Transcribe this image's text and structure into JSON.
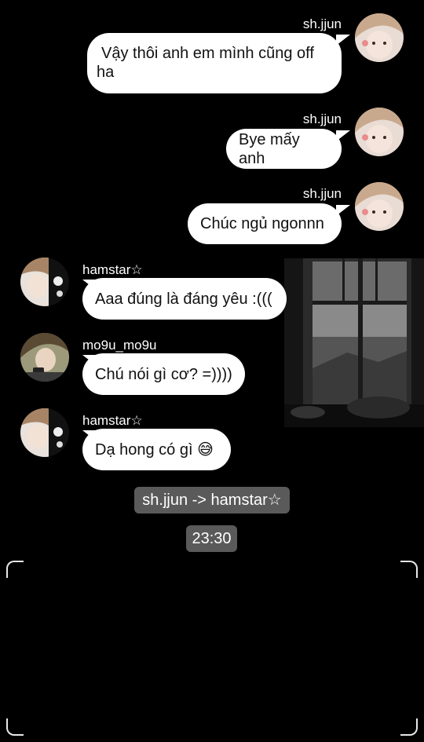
{
  "messages": [
    {
      "sender": "sh.jjun",
      "text": "Vậy thôi anh em mình cũng off ha",
      "line1": "Vậy thôi anh em mình cũng off",
      "line2": "ha"
    },
    {
      "sender": "sh.jjun",
      "text": "Bye mấy anh"
    },
    {
      "sender": "sh.jjun",
      "text": "Chúc ngủ ngonnn"
    },
    {
      "sender": "hamstar☆",
      "text": "Aaa đúng là đáng yêu :((("
    },
    {
      "sender": "mo9u_mo9u",
      "text": "Chú nói gì cơ? =))))"
    },
    {
      "sender": "hamstar☆",
      "text": "Dạ hong có gì 😅"
    }
  ],
  "system_labels": {
    "name_change": "sh.jjun -> hamstar☆",
    "time": "23:30"
  },
  "icons": {
    "avatar_shjjun": "profile-avatar",
    "avatar_hamstar": "profile-avatar",
    "avatar_mo9u": "profile-avatar",
    "photo": "window-photo"
  }
}
